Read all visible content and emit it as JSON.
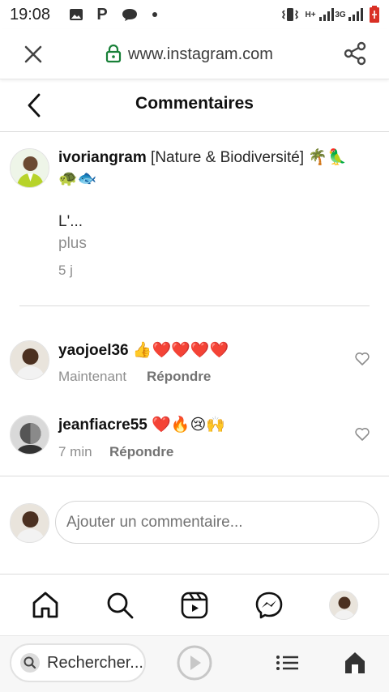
{
  "status_bar": {
    "time": "19:08",
    "network_label": "3G",
    "icons": [
      "image-icon",
      "p-app-icon",
      "chat-icon",
      "dot-icon",
      "vibrate-icon",
      "hplus-icon",
      "signal-icon",
      "signal-3g-icon",
      "battery-icon"
    ]
  },
  "browser": {
    "url": "www.instagram.com",
    "icons": [
      "close-icon",
      "lock-icon",
      "share-icon"
    ]
  },
  "header": {
    "title": "Commentaires"
  },
  "post": {
    "username": "ivoriangram",
    "caption": "[Nature & Biodiversité] 🌴🦜",
    "caption_emoji_line2": "🐢🐟",
    "caption_more_line": "L'...",
    "more_label": "plus",
    "age": "5 j"
  },
  "comments": [
    {
      "username": "yaojoel36",
      "emojis": "👍❤️❤️❤️❤️",
      "time": "Maintenant",
      "reply_label": "Répondre"
    },
    {
      "username": "jeanfiacre55",
      "emojis": "❤️🔥😢🙌",
      "time": "7 min",
      "reply_label": "Répondre"
    }
  ],
  "comment_input": {
    "placeholder": "Ajouter un commentaire..."
  },
  "bottom_nav": [
    "home-icon",
    "search-icon",
    "reels-icon",
    "messenger-icon",
    "profile-avatar"
  ],
  "system_bar": {
    "search_label": "Rechercher..."
  },
  "colors": {
    "accent_green": "#188038",
    "text": "#262626",
    "muted": "#8e8e8e"
  }
}
